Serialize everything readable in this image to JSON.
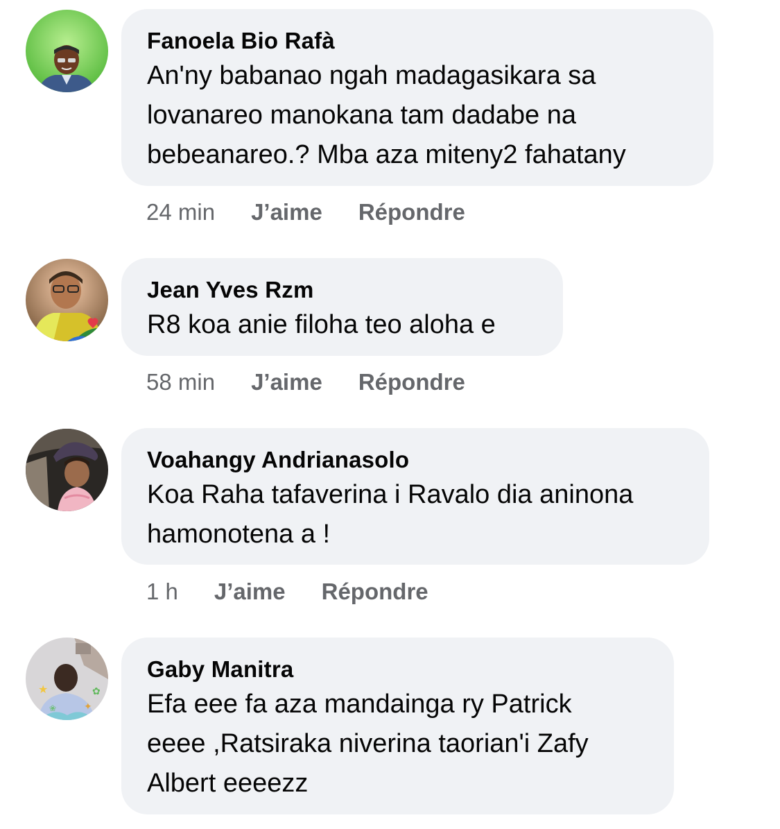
{
  "comments": [
    {
      "author": "Fanoela Bio Rafà",
      "text": "An'ny babanao ngah madagasikara sa\nlovanareo manokana tam dadabe na\nbebeanareo.? Mba aza miteny2 fahatany",
      "time": "24 min",
      "like_label": "J’aime",
      "reply_label": "Répondre"
    },
    {
      "author": "Jean Yves Rzm",
      "text": "R8 koa anie filoha teo aloha e",
      "time": "58 min",
      "like_label": "J’aime",
      "reply_label": "Répondre"
    },
    {
      "author": "Voahangy Andrianasolo",
      "text": "Koa Raha tafaverina i Ravalo dia aninona\nhamonotena a !",
      "time": "1 h",
      "like_label": "J’aime",
      "reply_label": "Répondre"
    },
    {
      "author": "Gaby Manitra",
      "text": "Efa eee fa aza mandainga ry Patrick\neeee ,Ratsiraka niverina taorian'i Zafy\nAlbert eeeezz",
      "time": "",
      "like_label": "",
      "reply_label": ""
    }
  ],
  "colors": {
    "bubble_bg": "#f0f2f5",
    "meta_text": "#65676b",
    "text": "#050505"
  }
}
